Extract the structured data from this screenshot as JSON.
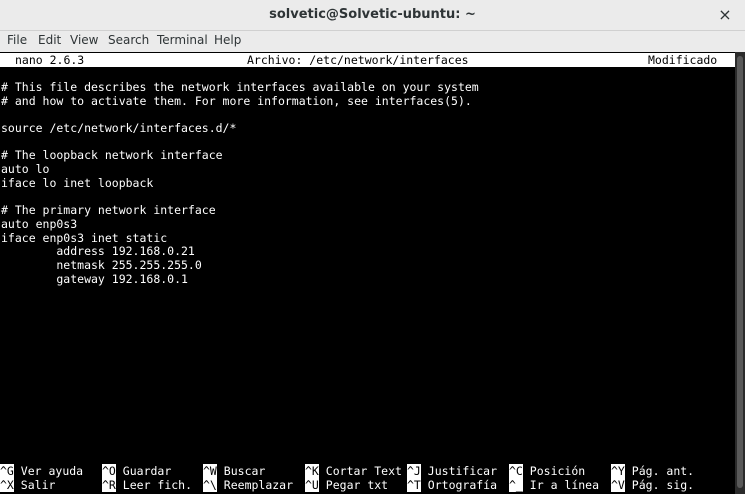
{
  "window": {
    "title": "solvetic@Solvetic-ubuntu: ~",
    "close_glyph": "×"
  },
  "menu": [
    "File",
    "Edit",
    "View",
    "Search",
    "Terminal",
    "Help"
  ],
  "nano": {
    "version": "nano 2.6.3",
    "file": "Archivo: /etc/network/interfaces",
    "state": "Modificado"
  },
  "content_lines": [
    "# This file describes the network interfaces available on your system",
    "# and how to activate them. For more information, see interfaces(5).",
    "",
    "source /etc/network/interfaces.d/*",
    "",
    "# The loopback network interface",
    "auto lo",
    "iface lo inet loopback",
    "",
    "# The primary network interface",
    "auto enp0s3",
    "iface enp0s3 inet static",
    "        address 192.168.0.21",
    "        netmask 255.255.255.0",
    "        gateway 192.168.0.1"
  ],
  "shortcuts_row1": [
    {
      "key": "^G",
      "label": "Ver ayuda"
    },
    {
      "key": "^O",
      "label": "Guardar"
    },
    {
      "key": "^W",
      "label": "Buscar"
    },
    {
      "key": "^K",
      "label": "Cortar Text"
    },
    {
      "key": "^J",
      "label": "Justificar"
    },
    {
      "key": "^C",
      "label": "Posición"
    },
    {
      "key": "^Y",
      "label": "Pág. ant."
    }
  ],
  "shortcuts_row2": [
    {
      "key": "^X",
      "label": "Salir"
    },
    {
      "key": "^R",
      "label": "Leer fich."
    },
    {
      "key": "^\\",
      "label": "Reemplazar"
    },
    {
      "key": "^U",
      "label": "Pegar txt"
    },
    {
      "key": "^T",
      "label": "Ortografía"
    },
    {
      "key": "^_",
      "label": "Ir a línea"
    },
    {
      "key": "^V",
      "label": "Pág. sig."
    }
  ]
}
